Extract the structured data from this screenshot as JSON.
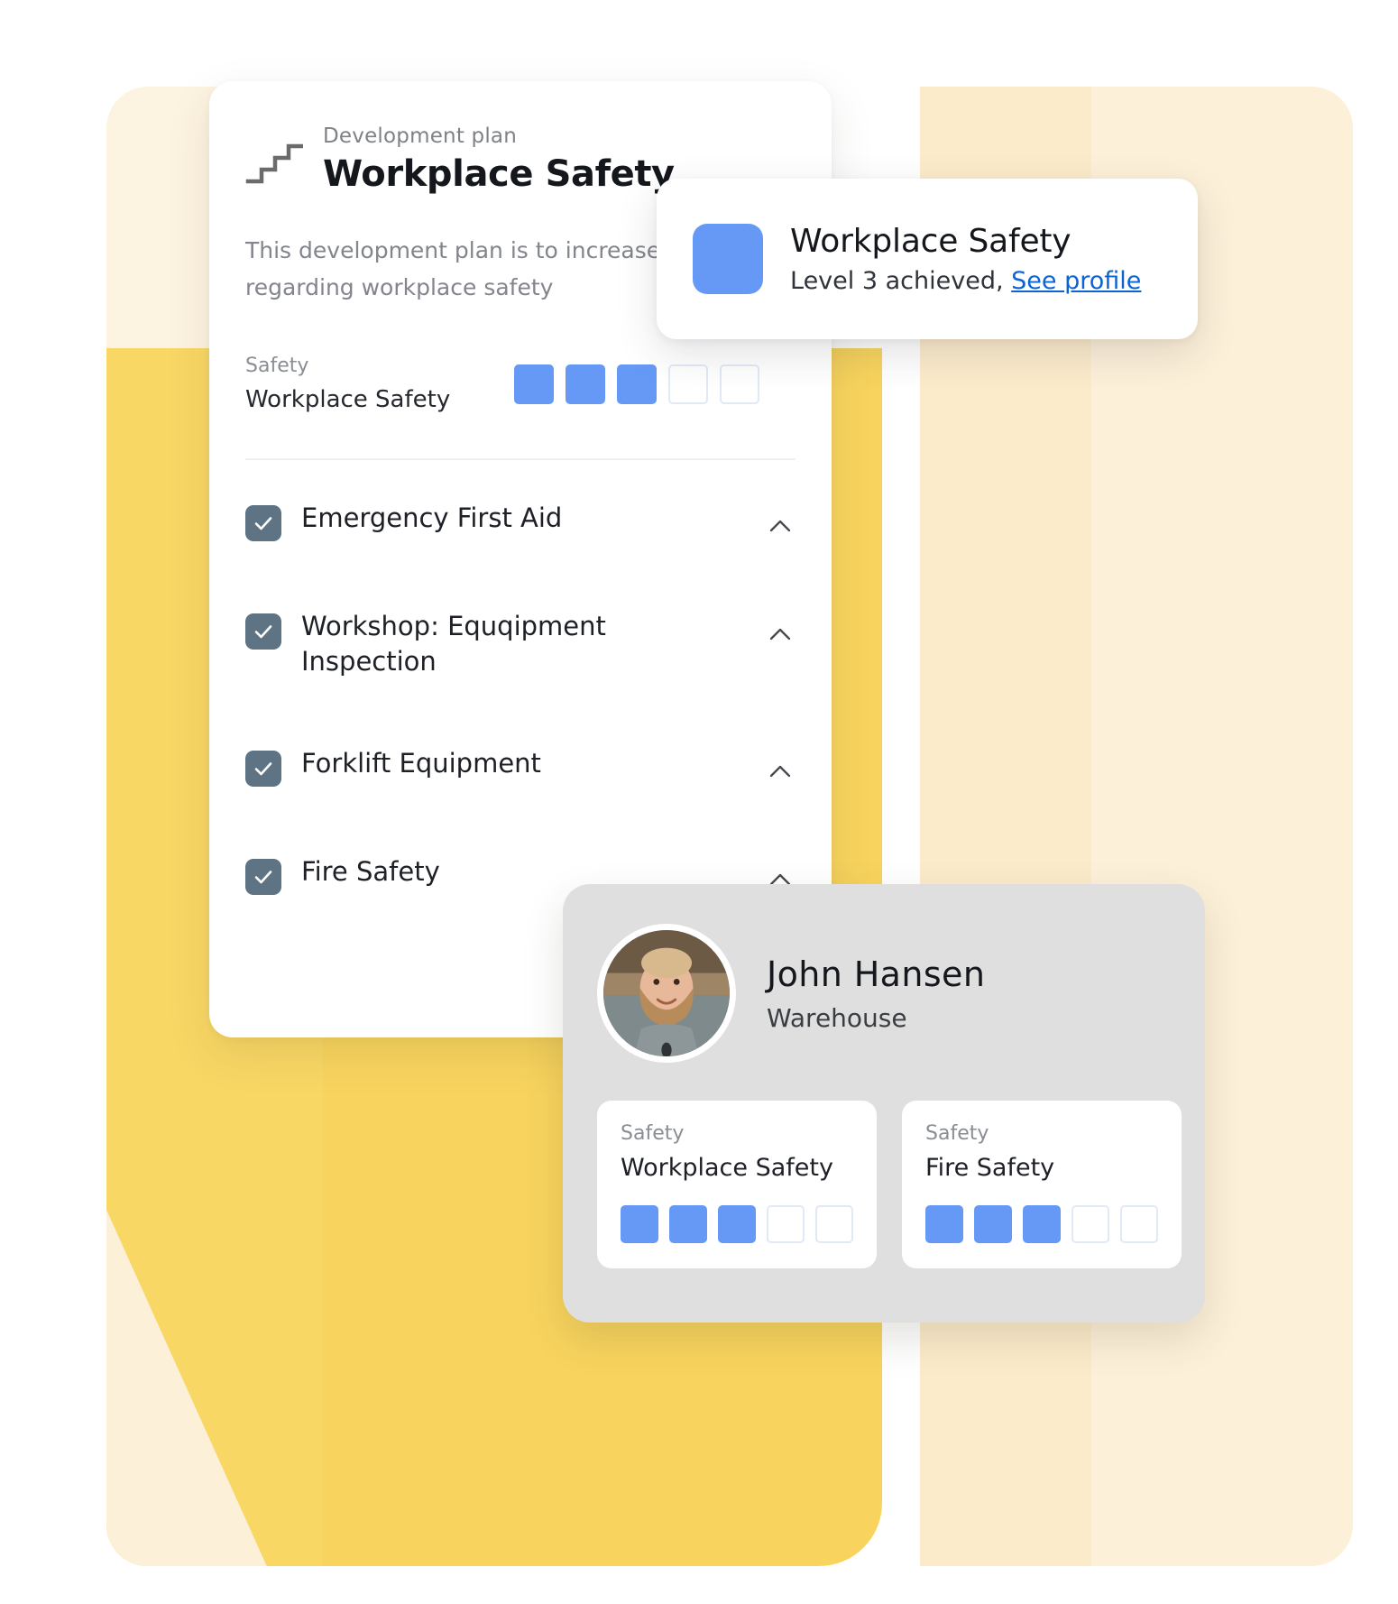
{
  "theme": {
    "accent_blue": "#6699f5",
    "link_blue": "#0c63d4",
    "brand_yellow": "#f8d45e",
    "brand_cream": "#fdf0d9",
    "checkbox_slate": "#5e7485",
    "profile_card_gray": "#dfdfdf"
  },
  "plan": {
    "eyebrow": "Development plan",
    "title": "Workplace Safety",
    "description": "This development plan is to increase regarding workplace safety",
    "icon": "stairs-icon",
    "skill": {
      "category": "Safety",
      "name": "Workplace Safety",
      "levels_total": 5,
      "levels_achieved": 3
    },
    "checklist": [
      {
        "label": "Emergency First Aid",
        "checked": true,
        "chevron": "chevron-up-icon"
      },
      {
        "label": "Workshop: Equqipment Inspection",
        "checked": true,
        "chevron": "chevron-up-icon"
      },
      {
        "label": "Forklift Equipment",
        "checked": true,
        "chevron": "chevron-up-icon"
      },
      {
        "label": "Fire Safety",
        "checked": true,
        "chevron": "chevron-up-icon"
      }
    ]
  },
  "toast": {
    "icon": "skill-badge-icon",
    "title": "Workplace Safety",
    "subtitle_text": "Level 3 achieved,",
    "link_label": "See profile"
  },
  "profile": {
    "avatar": "user-photo-avatar",
    "name": "John Hansen",
    "role": "Warehouse",
    "skills": [
      {
        "category": "Safety",
        "name": "Workplace Safety",
        "levels_total": 5,
        "levels_achieved": 3
      },
      {
        "category": "Safety",
        "name": "Fire Safety",
        "levels_total": 5,
        "levels_achieved": 3
      }
    ]
  }
}
